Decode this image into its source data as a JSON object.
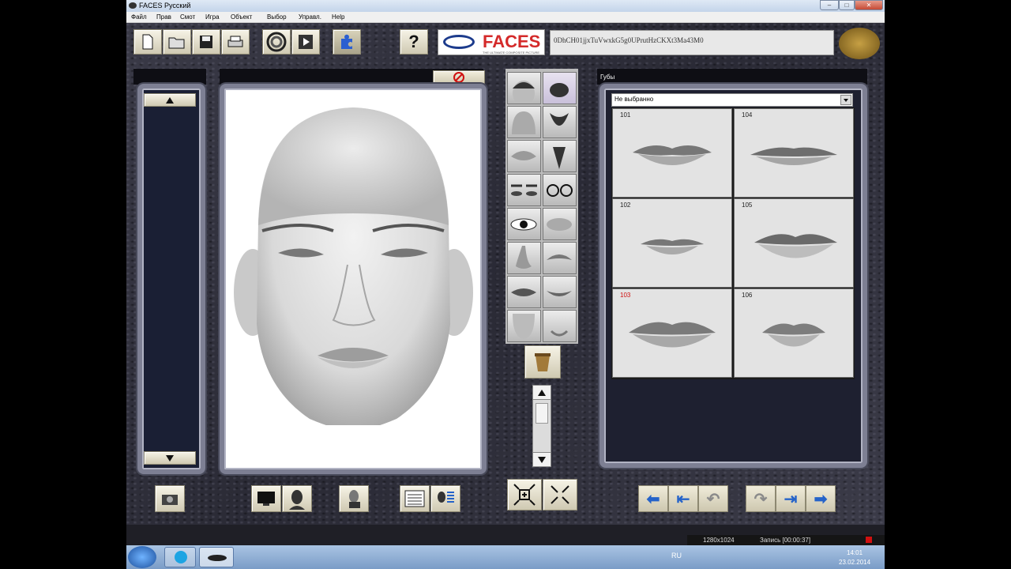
{
  "window": {
    "title": "FACES Русский",
    "controls": [
      "–",
      "□",
      "✕"
    ]
  },
  "menu": [
    "Файл",
    "Прав",
    "Смот",
    "Игра",
    "Объект",
    "Выбор",
    "Управл.",
    "Help"
  ],
  "toolbar": {
    "logo_text": "FACES",
    "logo_sub": "THE ULTIMATE COMPOSITE PICTURE",
    "code": "0DhCH01jjxTuVwxkG5g0UPrutHzCKXt3Ma43M0",
    "help_label": "?"
  },
  "feature_panel": {
    "title": "Губы",
    "dropdown_value": "Не выбранно",
    "items": [
      {
        "id": "101",
        "highlight": false
      },
      {
        "id": "104",
        "highlight": false
      },
      {
        "id": "102",
        "highlight": false
      },
      {
        "id": "105",
        "highlight": false
      },
      {
        "id": "103",
        "highlight": true
      },
      {
        "id": "106",
        "highlight": false
      }
    ],
    "highlight_color": "#d01010"
  },
  "feature_categories": [
    "head-shape",
    "hair-style",
    "hairline",
    "beard",
    "eyebrows",
    "goatee",
    "eyes",
    "glasses",
    "eye-detail",
    "lips-closeup",
    "nose",
    "mustache",
    "lips",
    "mouth-smile",
    "chin",
    "chin-detail"
  ],
  "status": {
    "resolution": "1280x1024",
    "record": "Запись [00:00:37]",
    "lang": "RU",
    "time": "14:01",
    "date": "23.02.2014"
  },
  "colors": {
    "accent": "#2563c9",
    "stop_red": "#d01010"
  }
}
